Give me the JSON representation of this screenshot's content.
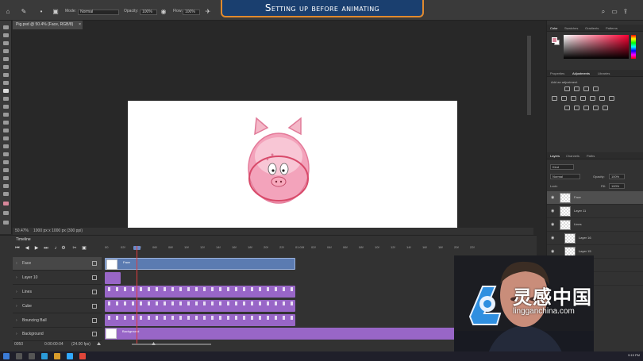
{
  "banner": {
    "title": "Setting up before animating"
  },
  "options_bar": {
    "mode_label": "Mode:",
    "mode_value": "Normal",
    "opacity_label": "Opacity:",
    "opacity_value": "100%",
    "flow_label": "Flow:",
    "flow_value": "100%"
  },
  "document": {
    "tab_title": "Pig.psd @ 50.4% (Face, RGB/8)",
    "zoom": "50.47%",
    "dimensions": "1000 px x 1000 px (300 ppi)"
  },
  "timeline": {
    "title": "Timeline",
    "ruler": [
      "00",
      "02f",
      "04f",
      "06f",
      "08f",
      "10f",
      "12f",
      "14f",
      "16f",
      "18f",
      "20f",
      "22f",
      "01:00f",
      "02f",
      "04f",
      "06f",
      "08f",
      "10f",
      "12f",
      "14f",
      "16f",
      "18f",
      "20f",
      "22f"
    ],
    "tracks": [
      {
        "name": "Face",
        "selected": true
      },
      {
        "name": "Layer 10",
        "selected": false
      },
      {
        "name": "Lines",
        "selected": false
      },
      {
        "name": "Cube",
        "selected": false
      },
      {
        "name": "Bouncing Ball",
        "selected": false
      },
      {
        "name": "Background",
        "selected": false
      }
    ],
    "clip_face_label": "Face",
    "clip_background_label": "Background",
    "frame_count": "0050",
    "timecode": "0:00:00:04",
    "fps": "(24.00 fps)"
  },
  "right_panel": {
    "color_tabs": [
      "Color",
      "Swatches",
      "Gradients",
      "Patterns"
    ],
    "adjust_tabs": [
      "Properties",
      "Adjustments",
      "Libraries"
    ],
    "add_adjustment": "Add an adjustment",
    "layer_tabs": [
      "Layers",
      "Channels",
      "Paths"
    ],
    "kind_filter": "Kind",
    "blend_mode": "Normal",
    "opacity_label": "Opacity:",
    "opacity_value": "100%",
    "lock_label": "Lock:",
    "fill_label": "Fill:",
    "fill_value": "100%",
    "layers": [
      {
        "name": "Face",
        "selected": true,
        "indent": 0
      },
      {
        "name": "Layer 11",
        "selected": false,
        "indent": 0
      },
      {
        "name": "Lines",
        "selected": false,
        "indent": 0
      },
      {
        "name": "Layer 16",
        "selected": false,
        "indent": 1
      },
      {
        "name": "Layer 15",
        "selected": false,
        "indent": 1
      },
      {
        "name": "Layer 14",
        "selected": false,
        "indent": 1
      },
      {
        "name": "Layer 13",
        "selected": false,
        "indent": 1
      }
    ],
    "bottom_layer": "Layer 19",
    "foreground_color": "#d7879a",
    "background_color": "#ffffff"
  },
  "watermark": {
    "chinese": "灵感中国",
    "url": "lingganchina.com"
  },
  "taskbar": {
    "clock": "9:15 PM"
  },
  "colors": {
    "accent_banner": "#1a3f6f",
    "banner_border": "#e08a2e",
    "clip_blue": "#5b7bb1",
    "clip_purple": "#9866c7",
    "playhead": "#e03c3c"
  }
}
